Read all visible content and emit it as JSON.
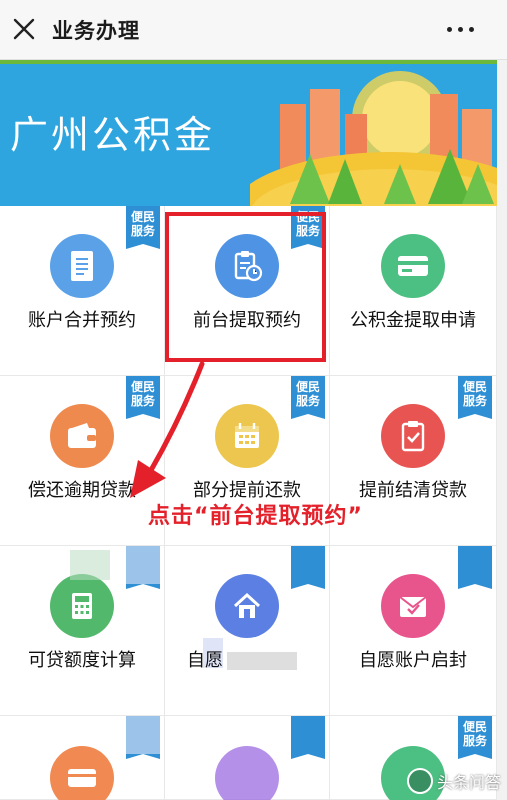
{
  "header": {
    "close_icon": "close-icon",
    "title": "业务办理",
    "more_icon": "more-dots-icon"
  },
  "banner": {
    "title": "广州公积金"
  },
  "badge_text": "便民服务",
  "services": [
    {
      "label": "账户合并预约",
      "icon": "document-icon",
      "color": "#5aa1e8"
    },
    {
      "label": "前台提取预约",
      "icon": "clipboard-clock-icon",
      "color": "#4f93e4"
    },
    {
      "label": "公积金提取申请",
      "icon": "card-icon",
      "color": "#4cbf82"
    },
    {
      "label": "偿还逾期贷款",
      "icon": "wallet-icon",
      "color": "#ef8a4f"
    },
    {
      "label": "部分提前还款",
      "icon": "calendar-icon",
      "color": "#ecc64f"
    },
    {
      "label": "提前结清贷款",
      "icon": "checklist-icon",
      "color": "#e85452"
    },
    {
      "label": "可贷额度计算",
      "icon": "calculator-icon",
      "color": "#52b86b"
    },
    {
      "label": "自愿",
      "icon": "house-icon",
      "color": "#5b7fe3"
    },
    {
      "label": "自愿账户启封",
      "icon": "envelope-check-icon",
      "color": "#e8548c"
    },
    {
      "label": "",
      "icon": "card-icon",
      "color": "#f08a52"
    },
    {
      "label": "",
      "icon": "purple-icon",
      "color": "#9b6be0"
    },
    {
      "label": "",
      "icon": "green-icon",
      "color": "#4cbf82"
    }
  ],
  "annotation": {
    "text": "点击“前台提取预约”",
    "color": "#e4212b"
  },
  "watermark": "头条问答"
}
